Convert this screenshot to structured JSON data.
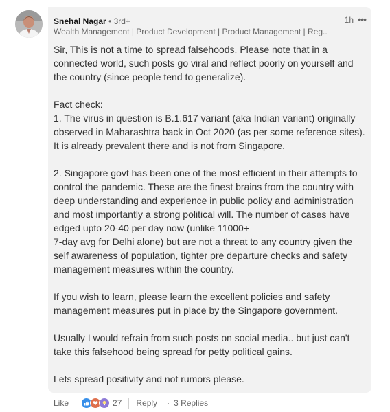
{
  "comment": {
    "author": "Snehal Nagar",
    "degree": "• 3rd+",
    "headline": "Wealth Management | Product Development | Product Management | Reg...",
    "time": "1h",
    "more": "•••",
    "paragraphs": [
      "Sir, This is not a time to spread falsehoods. Please note that in a connected world, such posts go viral and reflect poorly on yourself and the country (since people tend to generalize).",
      "Fact check:\n1. The virus in question is B.1.617 variant (aka Indian variant) originally observed in Maharashtra back in Oct 2020 (as per some reference sites). It is already prevalent there and is not from Singapore.",
      "2. Singapore govt has been one of the most efficient in their attempts to control the pandemic. These are the finest brains from the country with deep understanding and experience in public policy and administration and most importantly a strong political will. The number of cases have edged upto 20-40 per day now (unlike 11000+\n7-day avg for Delhi alone) but are not a threat to any country given the self awareness of population, tighter pre departure checks and safety management measures within the country.",
      "If you wish to learn, please learn the excellent policies and safety management measures put in place by the Singapore government.",
      "Usually I would refrain from such posts on social media.. but just can't take this falsehood being spread for petty political gains.",
      "Lets spread positivity and not rumors please."
    ]
  },
  "actions": {
    "like": "Like",
    "separator": "·",
    "reaction_count": "27",
    "reply": "Reply",
    "dot": "·",
    "replies": "3 Replies"
  },
  "reactions": [
    "like-icon",
    "love-icon",
    "insightful-icon"
  ],
  "colors": {
    "bubble": "#f2f2f2",
    "like": "#378fe9",
    "love": "#df704d",
    "insightful": "#8e7ad6"
  }
}
